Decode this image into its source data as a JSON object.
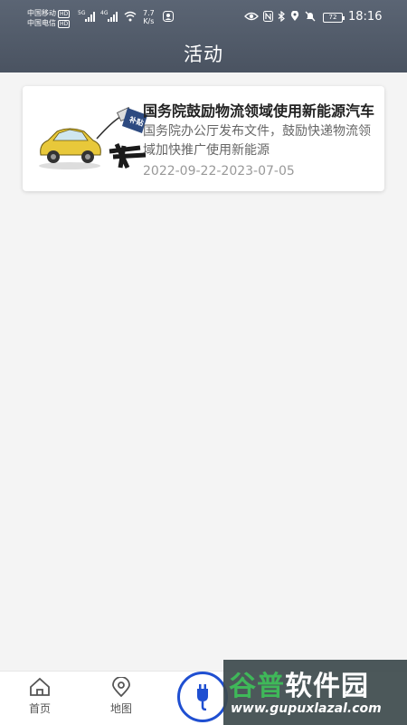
{
  "status_bar": {
    "carrier1": "中国移动",
    "carrier2": "中国电信",
    "hd": "HD",
    "net1": "5G",
    "net2": "4G",
    "speed_value": "7.7",
    "speed_unit": "K/s",
    "battery": "72",
    "time": "18:16"
  },
  "header": {
    "title": "活动"
  },
  "activities": [
    {
      "title": "国务院鼓励物流领域使用新能源汽车",
      "description": "国务院办公厅发布文件，鼓励快递物流领域加快推广使用新能源",
      "date_range": "2022-09-22-2023-07-05",
      "thumb_tag": "补贴"
    }
  ],
  "tabbar": {
    "home": "首页",
    "map": "地图"
  },
  "watermark": {
    "title_a": "谷普",
    "title_b": "软件园",
    "url": "www.gupuxlazal.com"
  },
  "colors": {
    "header": "#4f5866",
    "accent": "#1f4fd1"
  }
}
